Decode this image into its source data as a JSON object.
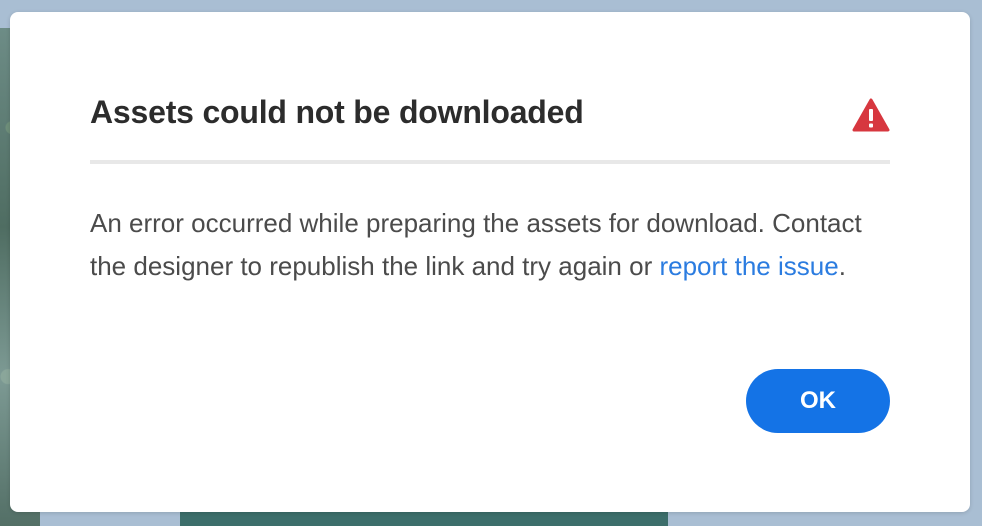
{
  "dialog": {
    "title": "Assets could not be downloaded",
    "alert_icon": "alert-triangle-icon",
    "message_part1": "An error occurred while preparing the assets for download. Contact the designer to republish the link and try again or ",
    "link_text": "report the issue",
    "message_end": ".",
    "ok_label": "OK"
  },
  "colors": {
    "accent": "#1473e6",
    "link": "#2b7ce0",
    "alert": "#d7373f",
    "title": "#2c2c2c",
    "text": "#4b4b4b"
  }
}
